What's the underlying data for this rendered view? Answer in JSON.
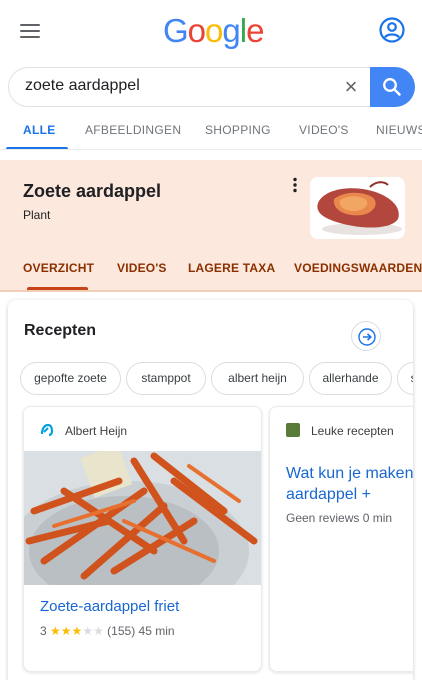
{
  "header": {
    "logo": [
      "G",
      "o",
      "o",
      "g",
      "l",
      "e"
    ]
  },
  "search": {
    "query": "zoete aardappel",
    "clear_glyph": "×"
  },
  "tabs": [
    {
      "label": "ALLE",
      "active": true
    },
    {
      "label": "AFBEELDINGEN",
      "active": false
    },
    {
      "label": "SHOPPING",
      "active": false
    },
    {
      "label": "VIDEO'S",
      "active": false
    },
    {
      "label": "NIEUWS",
      "active": false
    }
  ],
  "knowledge_panel": {
    "title": "Zoete aardappel",
    "subtitle": "Plant",
    "tabs": [
      "OVERZICHT",
      "VIDEO'S",
      "LAGERE TAXA",
      "VOEDINGSWAARDEN"
    ]
  },
  "recipes": {
    "title": "Recepten",
    "chips": [
      "gepofte zoete",
      "stamppot",
      "albert heijn",
      "allerhande",
      "sp"
    ],
    "cards": [
      {
        "source": "Albert Heijn",
        "title": "Zoete-aardappel friet",
        "rating": "3",
        "stars_filled": 3,
        "stars_total": 5,
        "reviews": "(155)",
        "time": "45 min"
      },
      {
        "source": "Leuke recepten",
        "title": "Wat kun je maken zoete aardappel +",
        "reviews": "Geen reviews",
        "time": "0 min"
      }
    ]
  },
  "colors": {
    "accent": "#1a73e8",
    "kp_background": "#fce8dc",
    "kp_tab": "#8a2f00",
    "link": "#1967d2",
    "star": "#fbbc05"
  }
}
